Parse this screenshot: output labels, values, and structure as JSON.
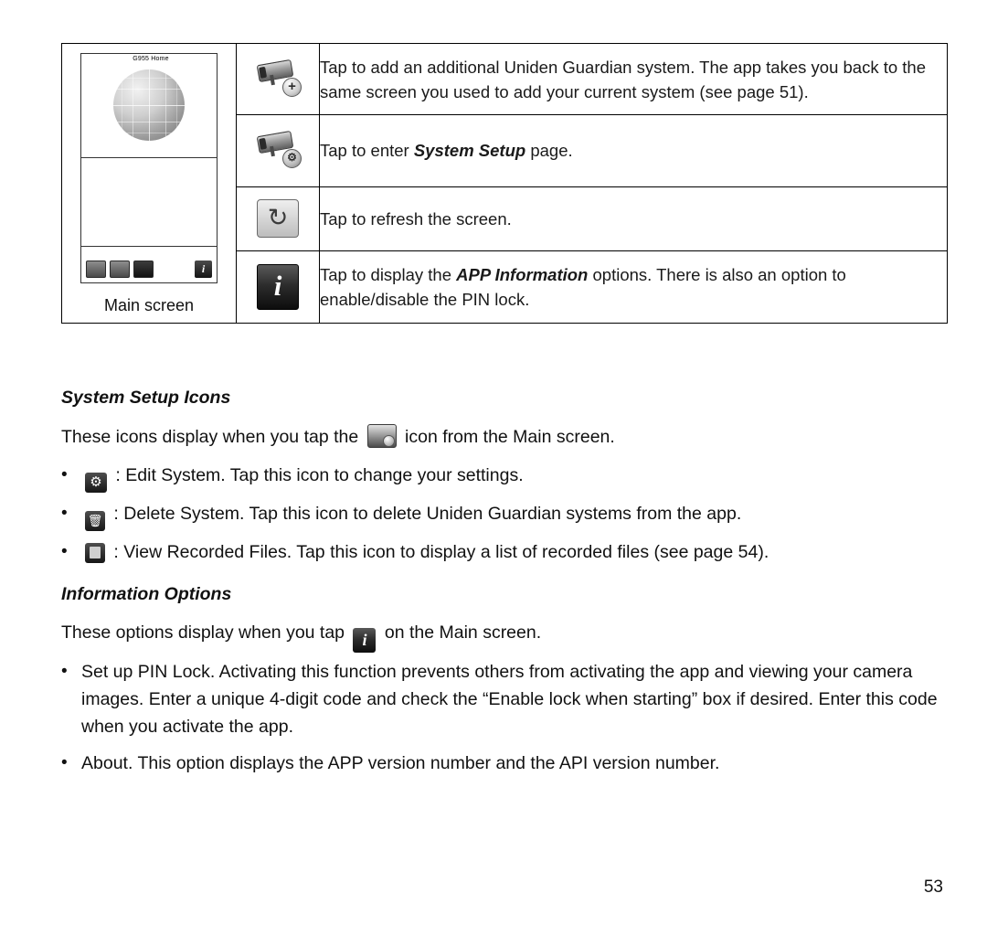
{
  "table": {
    "screen_cell": {
      "phone_title": "G955 Home",
      "caption": "Main screen",
      "icons": [
        "camera-icon",
        "camera-settings-icon",
        "refresh-icon",
        "info-icon"
      ]
    },
    "rows": [
      {
        "icon": "camera-add-icon",
        "badge": "+",
        "description": "Tap to add an additional Uniden Guardian system. The app takes you back to the same screen you used to add your current system (see page 51)."
      },
      {
        "icon": "camera-settings-icon",
        "badge": "⚙",
        "description_parts": [
          {
            "text": "Tap to enter ",
            "style": "normal"
          },
          {
            "text": "System Setup",
            "style": "italic-bold"
          },
          {
            "text": " page.",
            "style": "normal"
          }
        ]
      },
      {
        "icon": "refresh-icon",
        "glyph": "↻",
        "description": "Tap to refresh the screen."
      },
      {
        "icon": "info-icon",
        "glyph": "i",
        "description_parts": [
          {
            "text": "Tap to display the ",
            "style": "normal"
          },
          {
            "text": "APP Information",
            "style": "italic-bold"
          },
          {
            "text": " options. There is also an option to enable/disable the PIN lock.",
            "style": "normal"
          }
        ]
      }
    ]
  },
  "sections": [
    {
      "heading": "System Setup Icons",
      "intro_before": "These icons display when you tap the",
      "intro_icon": "camera-settings-icon",
      "intro_after": "icon from the Main screen.",
      "bullets": [
        {
          "icon": "gear-icon",
          "text": ": Edit System. Tap this icon to change your settings."
        },
        {
          "icon": "trash-icon",
          "text": ": Delete System. Tap this icon to delete Uniden Guardian systems from the app."
        },
        {
          "icon": "file-icon",
          "text": ": View Recorded Files. Tap this icon to display a list of recorded files (see page 54)."
        }
      ]
    },
    {
      "heading": "Information Options",
      "intro_before": "These options display when you tap",
      "intro_icon": "info-icon",
      "intro_after": "on the Main screen.",
      "bullets": [
        {
          "text": "Set up PIN Lock.  Activating this function prevents others from activating the app and viewing your camera images. Enter a unique 4-digit code and check the “Enable lock when starting” box if desired. Enter this code when you activate the app."
        },
        {
          "text": "About.  This option displays the APP version number and the API version number."
        }
      ]
    }
  ],
  "footer": {
    "page_number": "53"
  },
  "bullet_char": "•"
}
